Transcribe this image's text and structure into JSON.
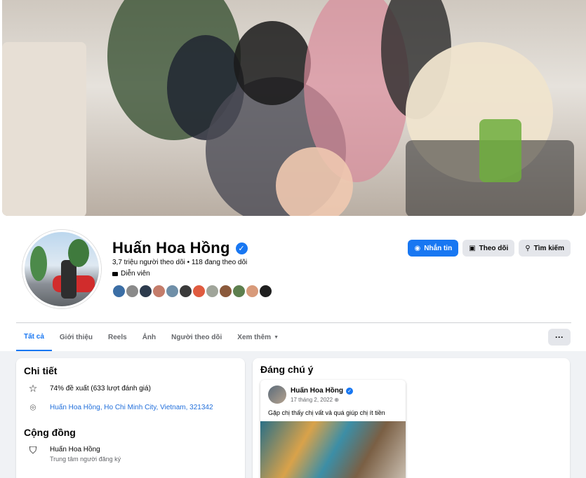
{
  "profile": {
    "name": "Huấn Hoa Hồng",
    "stats": "3,7 triệu người theo dõi • 118 đang theo dõi",
    "role": "Diễn viên",
    "verified_icon": "verified-badge-icon"
  },
  "actions": {
    "message": "Nhắn tin",
    "follow": "Theo dõi",
    "search": "Tìm kiếm"
  },
  "tabs": [
    {
      "label": "Tất cả",
      "active": true
    },
    {
      "label": "Giới thiệu"
    },
    {
      "label": "Reels"
    },
    {
      "label": "Ảnh"
    },
    {
      "label": "Người theo dõi"
    },
    {
      "label": "Xem thêm"
    }
  ],
  "more_label": "···",
  "details": {
    "title": "Chi tiết",
    "rating": "74% đề xuất (633 lượt đánh giá)",
    "location": "Huấn Hoa Hồng, Ho Chi Minh City, Vietnam, 321342"
  },
  "community": {
    "title": "Cộng đồng",
    "name": "Huấn Hoa Hồng",
    "subtitle": "Trung tâm người đăng ký"
  },
  "featured": {
    "title": "Đáng chú ý",
    "post": {
      "author": "Huấn Hoa Hồng",
      "date": "17 tháng 2, 2022",
      "text": "Gặp chị thấy chị vất vả quá giúp chị ít tiền"
    }
  },
  "colors": {
    "accent": "#1877f2",
    "page_bg": "#f0f2f5"
  }
}
